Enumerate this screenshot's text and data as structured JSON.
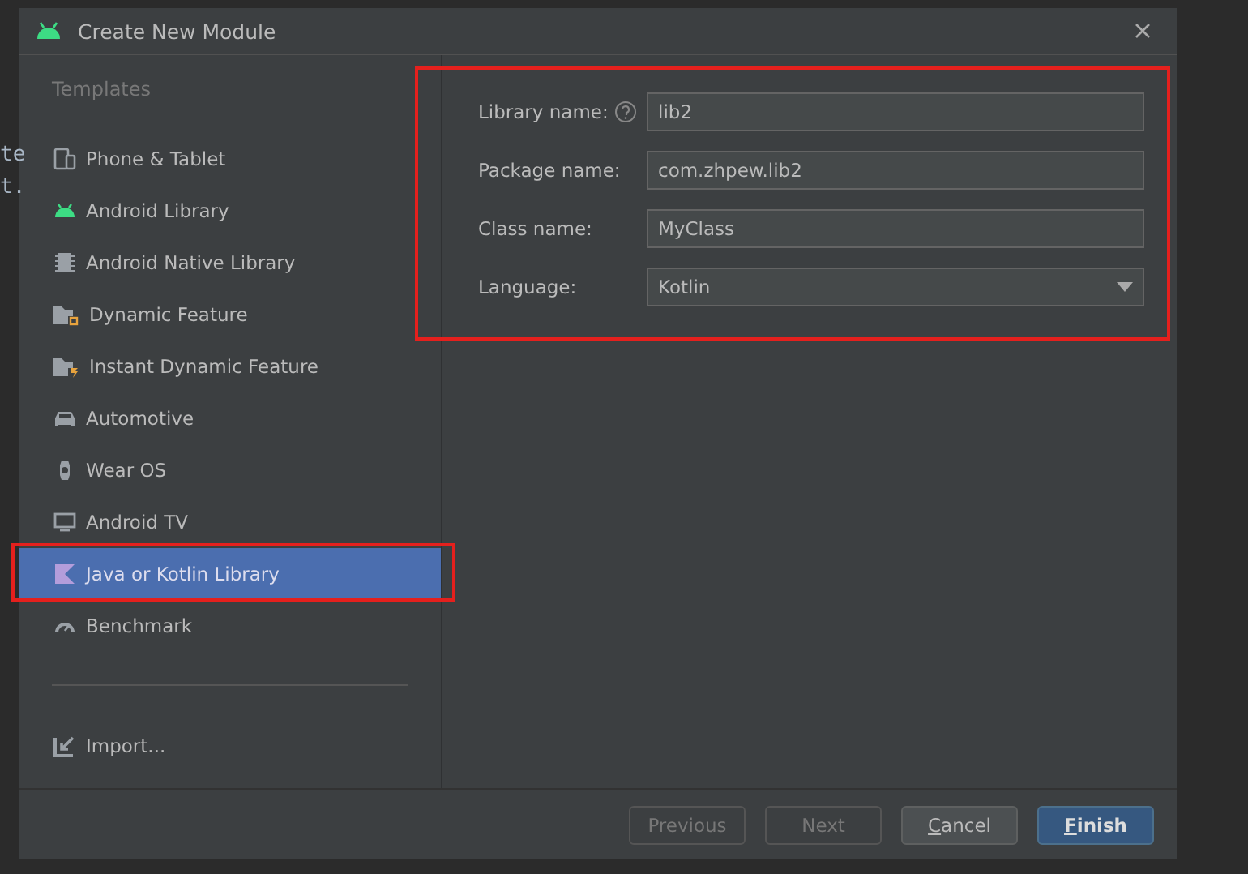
{
  "editor_fragments": [
    "te",
    "t."
  ],
  "window": {
    "title": "Create New Module"
  },
  "sidebar": {
    "heading": "Templates",
    "items": [
      {
        "label": "Phone & Tablet",
        "selected": false,
        "highlighted": false
      },
      {
        "label": "Android Library",
        "selected": false,
        "highlighted": false
      },
      {
        "label": "Android Native Library",
        "selected": false,
        "highlighted": false
      },
      {
        "label": "Dynamic Feature",
        "selected": false,
        "highlighted": false
      },
      {
        "label": "Instant Dynamic Feature",
        "selected": false,
        "highlighted": false
      },
      {
        "label": "Automotive",
        "selected": false,
        "highlighted": false
      },
      {
        "label": "Wear OS",
        "selected": false,
        "highlighted": false
      },
      {
        "label": "Android TV",
        "selected": false,
        "highlighted": false
      },
      {
        "label": "Java or Kotlin Library",
        "selected": true,
        "highlighted": true
      },
      {
        "label": "Benchmark",
        "selected": false,
        "highlighted": false
      }
    ],
    "import": "Import..."
  },
  "form": {
    "highlighted": true,
    "fields": [
      {
        "kind": "text",
        "label": "Library name:",
        "help": true,
        "value": "lib2"
      },
      {
        "kind": "text",
        "label": "Package name:",
        "help": false,
        "value": "com.zhpew.lib2"
      },
      {
        "kind": "text",
        "label": "Class name:",
        "help": false,
        "value": "MyClass"
      },
      {
        "kind": "dropdown",
        "label": "Language:",
        "help": false,
        "value": "Kotlin"
      }
    ]
  },
  "buttons": [
    {
      "label": "Previous",
      "disabled": true,
      "default": false,
      "mnemonic": false
    },
    {
      "label": "Next",
      "disabled": true,
      "default": false,
      "mnemonic": false
    },
    {
      "label": "Cancel",
      "disabled": false,
      "default": false,
      "mnemonic": true
    },
    {
      "label": "Finish",
      "disabled": false,
      "default": true,
      "mnemonic": true
    }
  ]
}
